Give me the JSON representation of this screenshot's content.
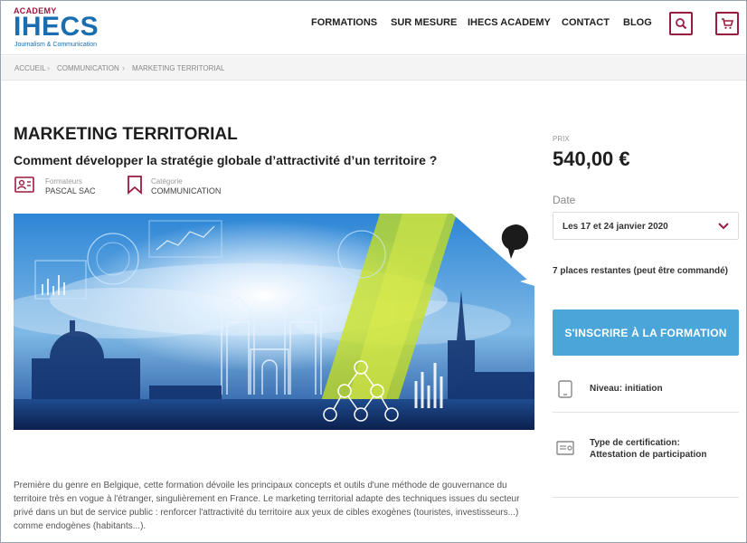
{
  "header": {
    "logo": {
      "academy": "ACADEMY",
      "name": "IHECS",
      "tagline": "Journalism & Communication"
    },
    "nav": [
      "FORMATIONS",
      "SUR MESURE",
      "IHECS ACADEMY",
      "CONTACT",
      "BLOG"
    ],
    "icons": [
      "search-icon",
      "cart-icon"
    ]
  },
  "breadcrumb": [
    "ACCUEIL",
    "COMMUNICATION",
    "MARKETING TERRITORIAL"
  ],
  "course": {
    "title": "MARKETING TERRITORIAL",
    "subtitle": "Comment développer la stratégie globale d’attractivité d’un territoire ?",
    "trainer_label": "Formateurs",
    "trainer": "PASCAL SAC",
    "category_label": "Catégorie",
    "category": "COMMUNICATION",
    "description": "Première du genre en Belgique, cette formation dévoile les principaux concepts et outils d'une méthode de gouvernance du territoire très en vogue à l'étranger, singulièrement en France. Le marketing territorial adapte des techniques issues du secteur privé dans un but de service public : renforcer l'attractivité du territoire aux yeux de cibles exogènes (touristes, investisseurs...) comme endogènes (habitants...)."
  },
  "sidebar": {
    "price_label": "PRIX",
    "price": "540,00 €",
    "date_label": "Date",
    "date_value": "Les 17 et 24 janvier 2020",
    "places": "7 places restantes (peut être commandé)",
    "cta": "S'INSCRIRE À LA FORMATION",
    "level": "Niveau: initiation",
    "certification_line1": "Type de certification:",
    "certification_line2": "Attestation de participation"
  },
  "colors": {
    "brand_red": "#9a1b3f",
    "brand_blue": "#1a6db0",
    "cta_blue": "#4aa5d8"
  }
}
